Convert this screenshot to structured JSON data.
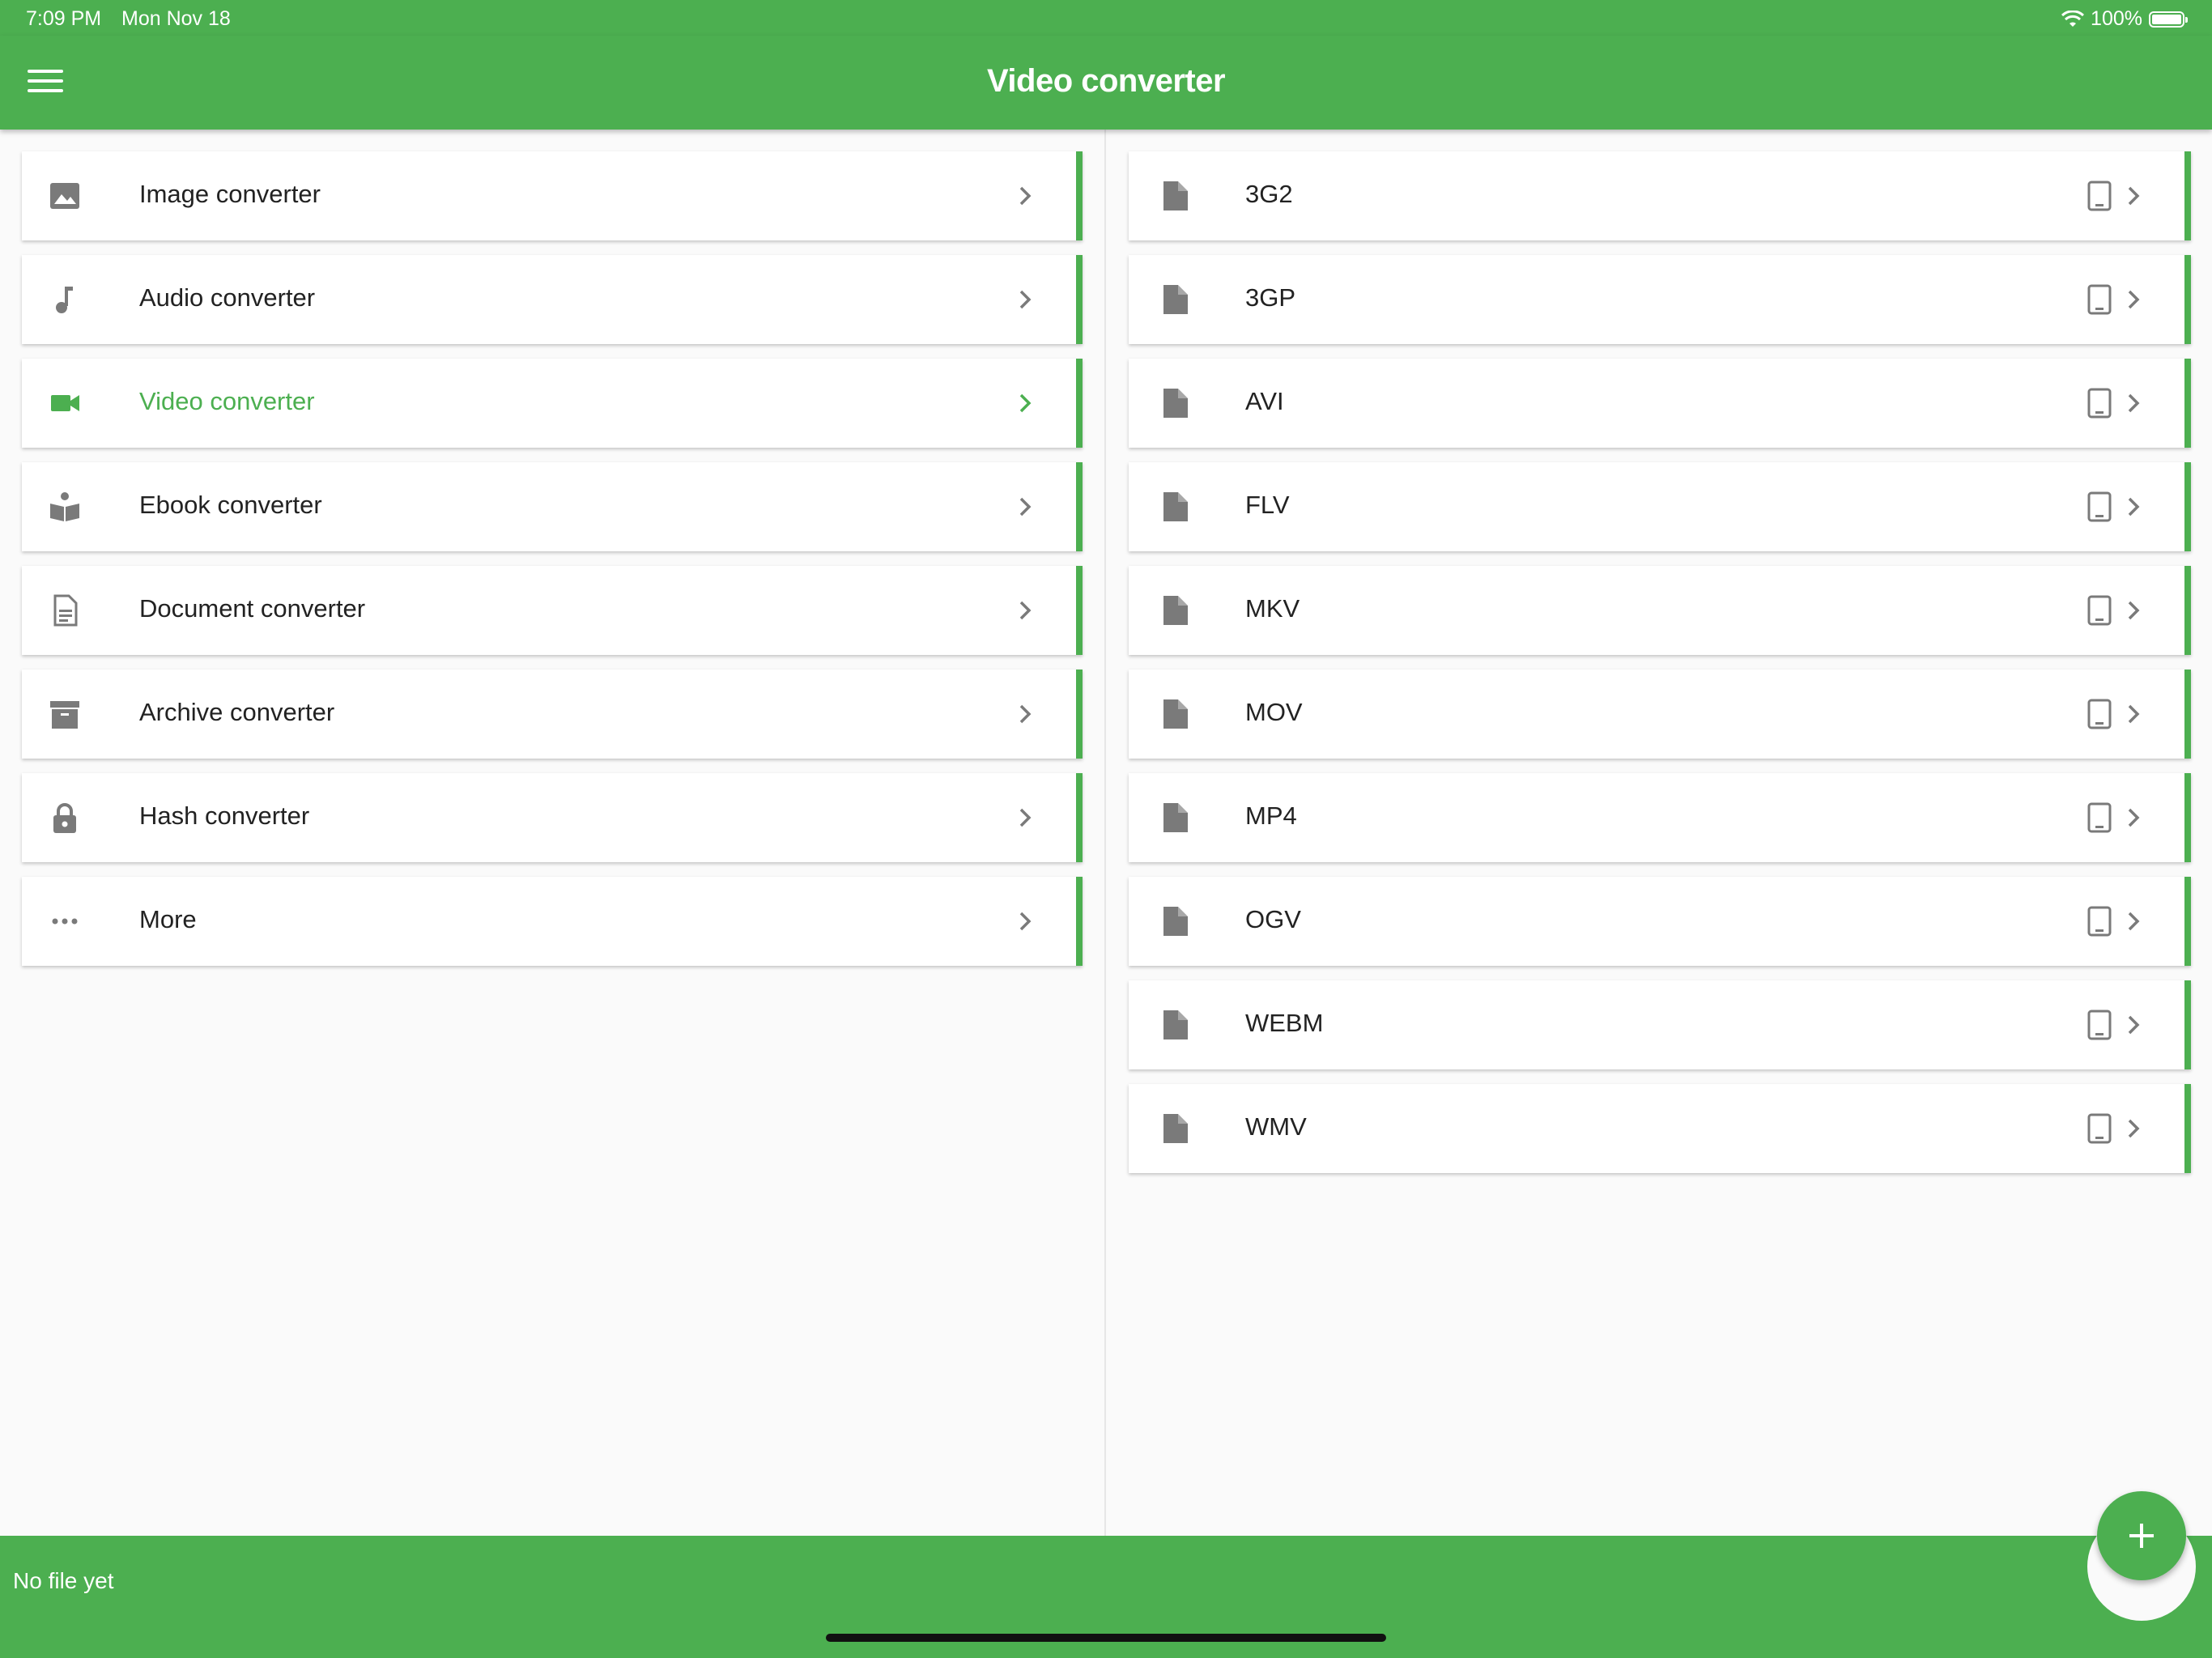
{
  "status_bar": {
    "time": "7:09 PM",
    "date": "Mon Nov 18",
    "battery": "100%"
  },
  "app_bar": {
    "title": "Video converter",
    "menu_icon": "hamburger-menu-icon"
  },
  "sidebar": {
    "items": [
      {
        "label": "Image converter",
        "icon": "image-icon"
      },
      {
        "label": "Audio converter",
        "icon": "music-note-icon"
      },
      {
        "label": "Video converter",
        "icon": "videocam-icon",
        "active": true
      },
      {
        "label": "Ebook converter",
        "icon": "book-reader-icon"
      },
      {
        "label": "Document converter",
        "icon": "document-icon"
      },
      {
        "label": "Archive converter",
        "icon": "archive-box-icon"
      },
      {
        "label": "Hash converter",
        "icon": "lock-icon"
      },
      {
        "label": "More",
        "icon": "more-dots-icon"
      }
    ]
  },
  "formats": {
    "items": [
      {
        "label": "3G2"
      },
      {
        "label": "3GP"
      },
      {
        "label": "AVI"
      },
      {
        "label": "FLV"
      },
      {
        "label": "MKV"
      },
      {
        "label": "MOV"
      },
      {
        "label": "MP4"
      },
      {
        "label": "OGV"
      },
      {
        "label": "WEBM"
      },
      {
        "label": "WMV"
      }
    ],
    "file_icon": "file-icon",
    "device_icon": "tablet-icon"
  },
  "bottom_bar": {
    "status": "No file yet"
  },
  "colors": {
    "accent": "#4caf50",
    "icon_gray": "#7a7a7a"
  }
}
